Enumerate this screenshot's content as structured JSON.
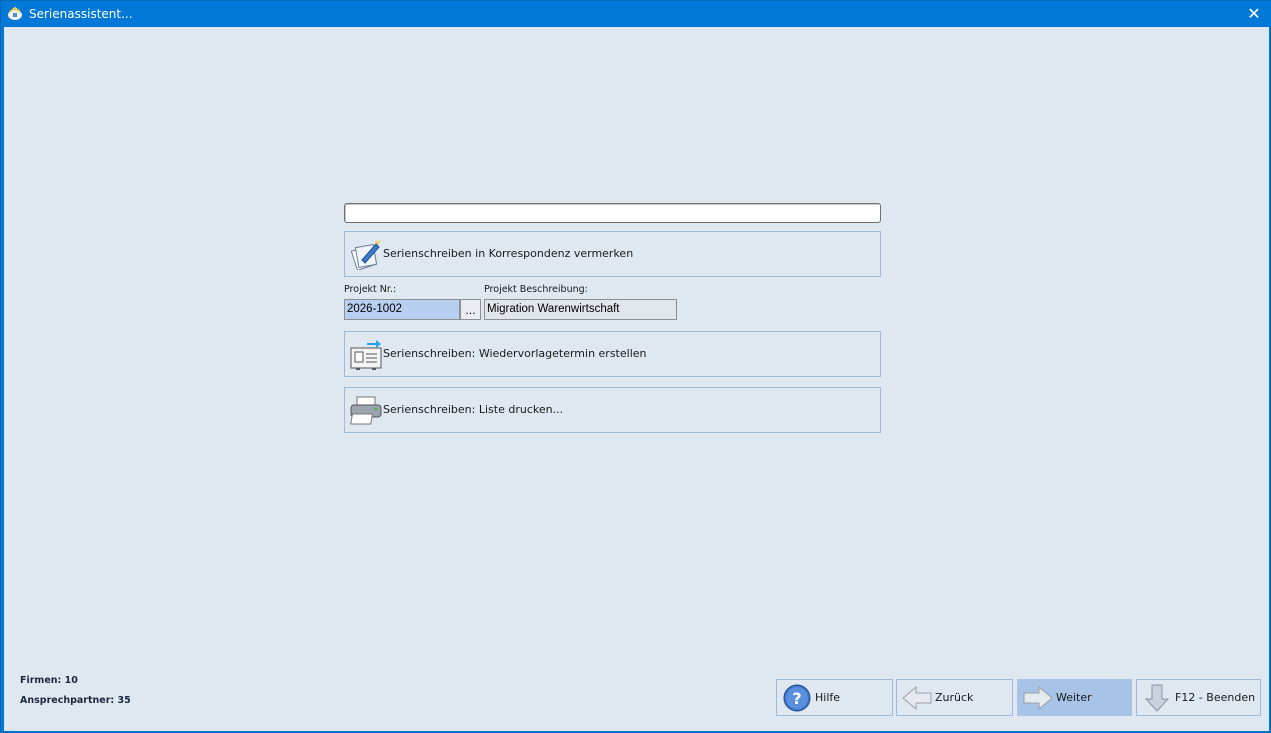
{
  "window": {
    "title": "Serienassistent..."
  },
  "actions": {
    "korrespondenz": {
      "label": "Serienschreiben in Korrespondenz vermerken",
      "icon": "document-pen-icon"
    },
    "wiedervorlage": {
      "label": "Serienschreiben: Wiedervorlagetermin erstellen",
      "icon": "calendar-note-icon"
    },
    "liste": {
      "label": "Serienschreiben: Liste drucken...",
      "icon": "printer-icon"
    }
  },
  "project": {
    "nr_label": "Projekt Nr.:",
    "nr_value": "2026-1002",
    "browse_label": "...",
    "desc_label": "Projekt Beschreibung:",
    "desc_value": "Migration Warenwirtschaft"
  },
  "stats": {
    "firmen": "Firmen: 10",
    "ansprechpartner": "Ansprechpartner: 35"
  },
  "nav": {
    "hilfe": "Hilfe",
    "zurueck": "Zurück",
    "weiter": "Weiter",
    "beenden": "F12 - Beenden"
  },
  "colors": {
    "titlebar": "#0078d7",
    "background": "#dfe7f1",
    "button_border": "#9fb9db",
    "active_button": "#a7c3e6"
  }
}
